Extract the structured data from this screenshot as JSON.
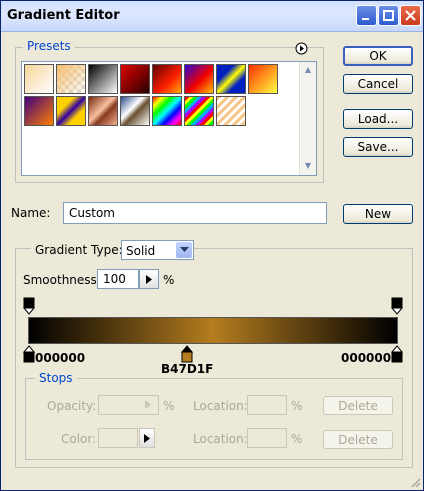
{
  "window": {
    "title": "Gradient Editor"
  },
  "presets": {
    "label": "Presets",
    "swatches": [
      {
        "name": "fg-to-bg"
      },
      {
        "name": "fg-to-transparent"
      },
      {
        "name": "black-white"
      },
      {
        "name": "red-black"
      },
      {
        "name": "red-orange"
      },
      {
        "name": "violet-red-orange"
      },
      {
        "name": "blue-yellow-blue"
      },
      {
        "name": "orange-yellow"
      },
      {
        "name": "violet-orange"
      },
      {
        "name": "yellow-violet"
      },
      {
        "name": "copper"
      },
      {
        "name": "chrome"
      },
      {
        "name": "spectrum"
      },
      {
        "name": "rainbow-stripes"
      },
      {
        "name": "transparent-stripes"
      }
    ]
  },
  "buttons": {
    "ok": "OK",
    "cancel": "Cancel",
    "load": "Load...",
    "save": "Save...",
    "new": "New",
    "delete_opacity": "Delete",
    "delete_color": "Delete"
  },
  "name_field": {
    "label": "Name:",
    "value": "Custom"
  },
  "gradient_type": {
    "label": "Gradient Type:",
    "value": "Solid"
  },
  "smoothness": {
    "label": "Smoothness:",
    "value": "100",
    "unit": "%"
  },
  "gradient": {
    "colors": {
      "left": "#000000",
      "center": "#b47d1f",
      "right": "#000000"
    },
    "left_stop_label": "000000",
    "center_stop_label": "B47D1F",
    "right_stop_label": "000000"
  },
  "stops": {
    "label": "Stops",
    "opacity_label": "Opacity:",
    "opacity_unit": "%",
    "opacity_location_label": "Location:",
    "opacity_location_unit": "%",
    "color_label": "Color:",
    "color_location_label": "Location:",
    "color_location_unit": "%"
  },
  "icons": {
    "presets_menu": "circle-arrow-icon",
    "minimize": "minimize-icon",
    "maximize": "maximize-icon",
    "close": "close-icon"
  }
}
